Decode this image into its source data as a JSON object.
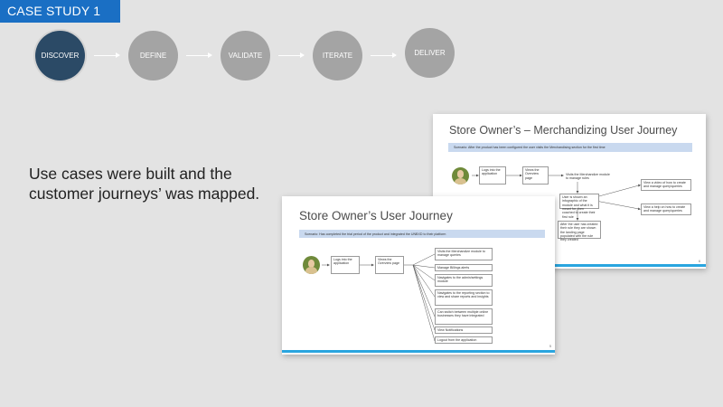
{
  "header": {
    "tag": "CASE STUDY 1"
  },
  "process": {
    "steps": [
      {
        "label": "DISCOVER",
        "active": true
      },
      {
        "label": "DEFINE",
        "active": false
      },
      {
        "label": "VALIDATE",
        "active": false
      },
      {
        "label": "ITERATE",
        "active": false
      },
      {
        "label": "DELIVER",
        "active": false
      }
    ]
  },
  "lead_text": {
    "line1": "Use cases were built and the",
    "line2": "customer journeys’ was mapped."
  },
  "slide_merch": {
    "title": "Store Owner’s – Merchandizing User Journey",
    "scenario": "Scenario: After the product has been configured the user visits the Merchandising section for the first time",
    "boxes": {
      "login": "Logs into the application",
      "overview": "Views the Overview page",
      "visits": "Visits the Merchandize module to manage rules",
      "infographic": "User is shown an infographic of the module and what it is meant for, then coached to create their first rule",
      "video": "View a video of how to create and manage query/queries",
      "help": "View a help on how to create and manage query/queries",
      "after": "After the user has created their rule they are shown the landing page populated with the rule they created"
    },
    "page": "6"
  },
  "slide_journey": {
    "title": "Store Owner’s User Journey",
    "scenario": "Scenario: Has completed the trial period of the product  and integrated the UNBXD to their platform",
    "boxes": {
      "login": "Logs into the application",
      "overview": "Views the Overview page"
    },
    "options": [
      "Visits the Merchandize module to manage queries",
      "Manage Billings alerts",
      "Navigates to the admin/settings module",
      "Navigates to the reporting section to view and share reports and insights",
      "Can switch between multiple online businesses they have integrated",
      "View Notifications",
      "Logout from the application"
    ],
    "page": "5"
  }
}
